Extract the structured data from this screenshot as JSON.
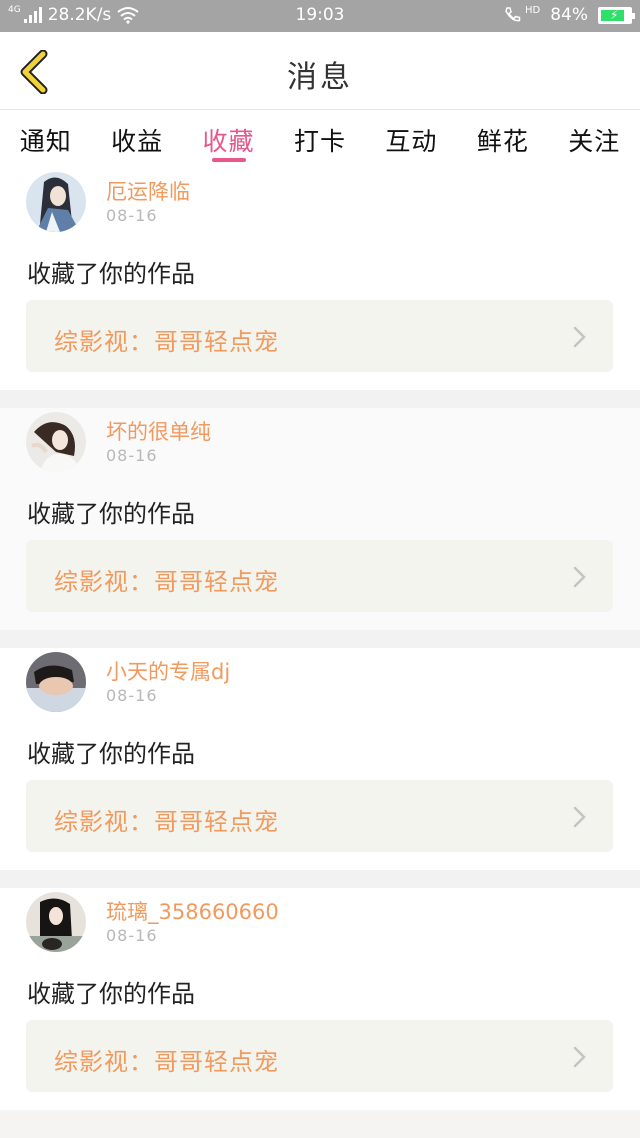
{
  "status_bar": {
    "network": "4G",
    "speed": "28.2K/s",
    "time": "19:03",
    "hd": "HD",
    "battery": "84%",
    "battery_level": 0.84
  },
  "header": {
    "title": "消息"
  },
  "tabs": [
    {
      "label": "通知",
      "active": false
    },
    {
      "label": "收益",
      "active": false
    },
    {
      "label": "收藏",
      "active": true
    },
    {
      "label": "打卡",
      "active": false
    },
    {
      "label": "互动",
      "active": false
    },
    {
      "label": "鲜花",
      "active": false
    },
    {
      "label": "关注",
      "active": false
    }
  ],
  "messages": [
    {
      "username": "厄运降临",
      "date": "08-16",
      "action": "收藏了你的作品",
      "work_title": "综影视：哥哥轻点宠"
    },
    {
      "username": "坏的很单纯",
      "date": "08-16",
      "action": "收藏了你的作品",
      "work_title": "综影视：哥哥轻点宠"
    },
    {
      "username": "小天的专属dj",
      "date": "08-16",
      "action": "收藏了你的作品",
      "work_title": "综影视：哥哥轻点宠"
    },
    {
      "username": "琉璃_358660660",
      "date": "08-16",
      "action": "收藏了你的作品",
      "work_title": "综影视：哥哥轻点宠"
    }
  ],
  "colors": {
    "accent": "#e8578b",
    "username": "#f29a5e",
    "back_arrow": "#f2d23a"
  }
}
